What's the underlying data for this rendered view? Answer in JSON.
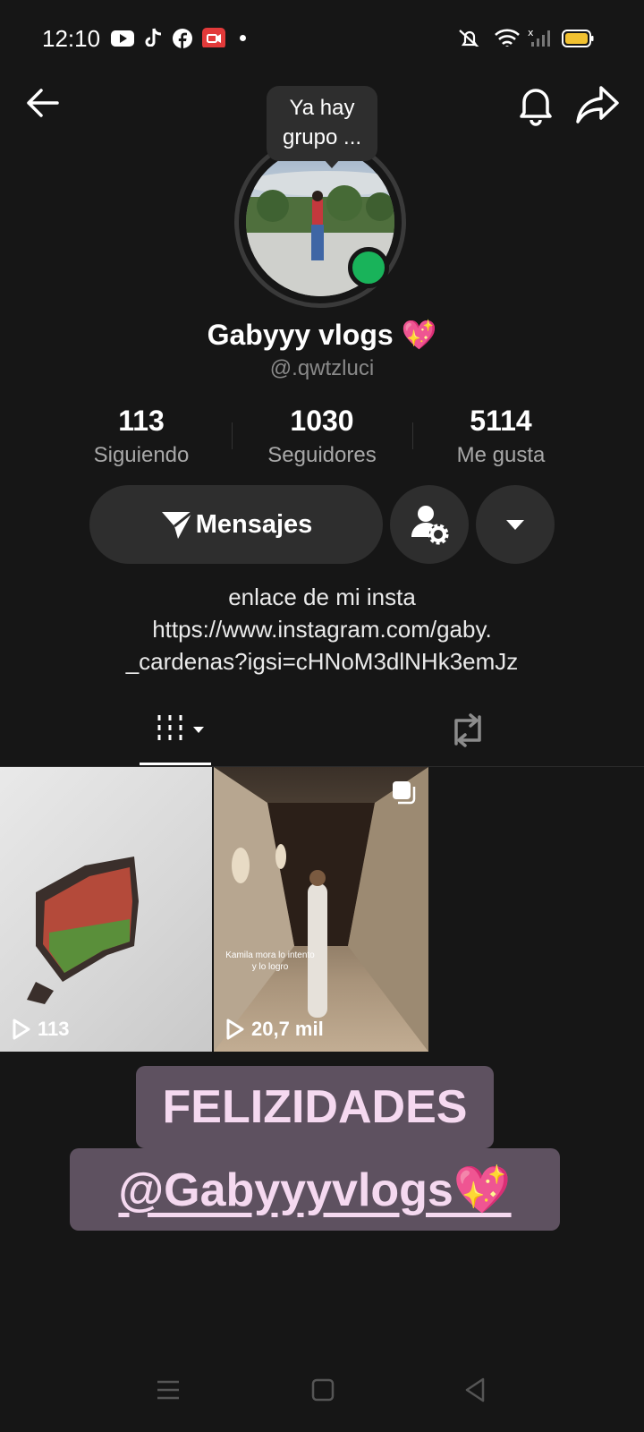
{
  "status_bar": {
    "time": "12:10",
    "left_icons": [
      "youtube-icon",
      "tiktok-icon",
      "facebook-icon",
      "screen-record-icon",
      "dot-icon"
    ],
    "right_icons": [
      "mute-icon",
      "wifi-icon",
      "signal-icon",
      "battery-icon"
    ]
  },
  "header": {
    "back_icon": "arrow-left-icon",
    "bell_icon": "bell-icon",
    "share_icon": "share-icon"
  },
  "profile": {
    "note_bubble": "Ya hay grupo ...",
    "display_name": "Gabyyy vlogs 💖",
    "username": "@.qwtzluci",
    "online_color": "#19b35a"
  },
  "stats": [
    {
      "value": "113",
      "label": "Siguiendo"
    },
    {
      "value": "1030",
      "label": "Seguidores"
    },
    {
      "value": "5114",
      "label": "Me gusta"
    }
  ],
  "actions": {
    "message_label": "Mensajes",
    "add_friend_icon": "user-settings-icon",
    "more_icon": "caret-down-icon"
  },
  "bio": {
    "line1": "enlace de mi insta",
    "line2": "https://www.instagram.com/gaby.",
    "line3": "_cardenas?igsi=cHNoM3dlNHk3emJz"
  },
  "tabs": [
    {
      "name": "videos",
      "icon": "grid-bars-icon",
      "active": true
    },
    {
      "name": "reposts",
      "icon": "repost-icon",
      "active": false
    }
  ],
  "videos": [
    {
      "views": "113"
    },
    {
      "views": "20,7 mil",
      "caption": "Kamila mora lo intento y lo logro"
    }
  ],
  "sticker": {
    "line1": "FELIZIDADES",
    "line2": "@Gabyyyvlogs💖"
  },
  "nav": [
    "menu-icon",
    "home-square-icon",
    "back-triangle-icon"
  ]
}
